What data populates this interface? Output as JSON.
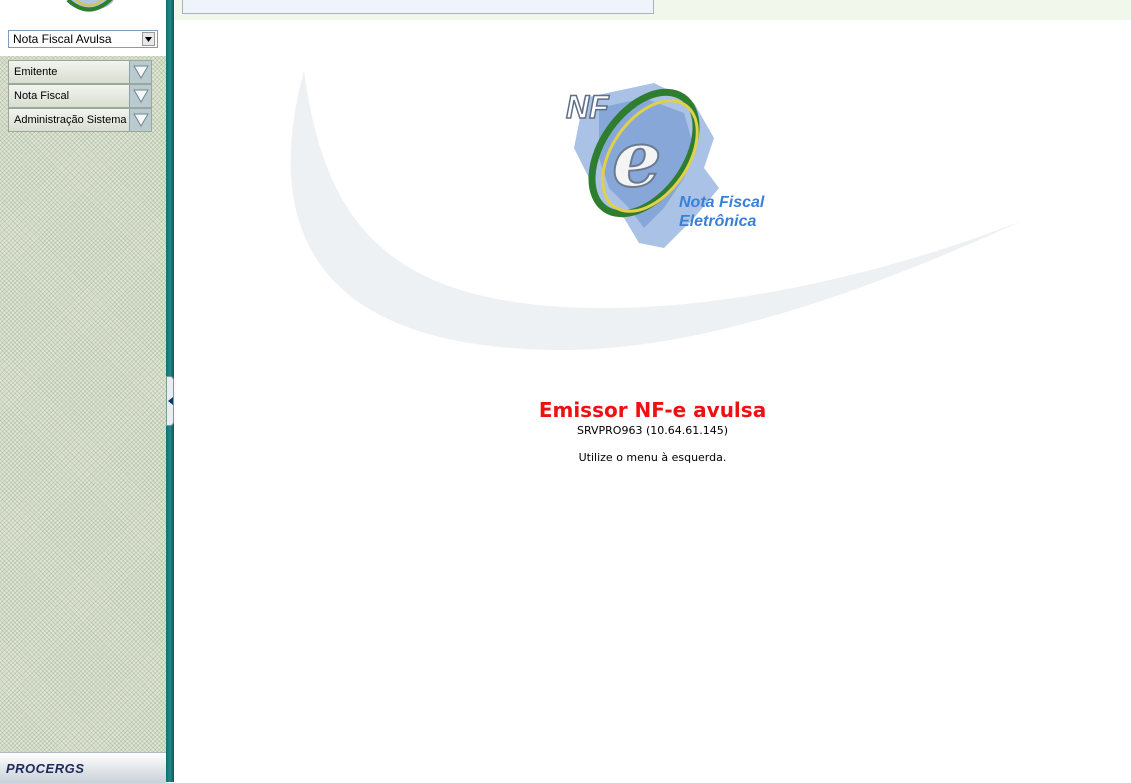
{
  "sidebar": {
    "select_value": "Nota Fiscal Avulsa",
    "menu": [
      {
        "label": "Emitente"
      },
      {
        "label": "Nota Fiscal"
      },
      {
        "label": "Administração Sistema"
      }
    ],
    "footer_logo": "PROCERGS"
  },
  "main": {
    "logo_caption_line1": "Nota Fiscal",
    "logo_caption_line2": "Eletrônica",
    "app_title": "Emissor NF-e avulsa",
    "server_info": "SRVPRO963 (10.64.61.145)",
    "instruction": "Utilize o menu à esquerda."
  },
  "colors": {
    "title_red": "#ee1111",
    "caption_blue": "#3a7fd8",
    "divider_teal": "#0f6f6f",
    "sidebar_bg": "#dfe6d4"
  },
  "icons": [
    "nfe-logo-icon",
    "dropdown-arrow-icon",
    "expand-triangle-icon",
    "collapse-arrow-icon"
  ]
}
